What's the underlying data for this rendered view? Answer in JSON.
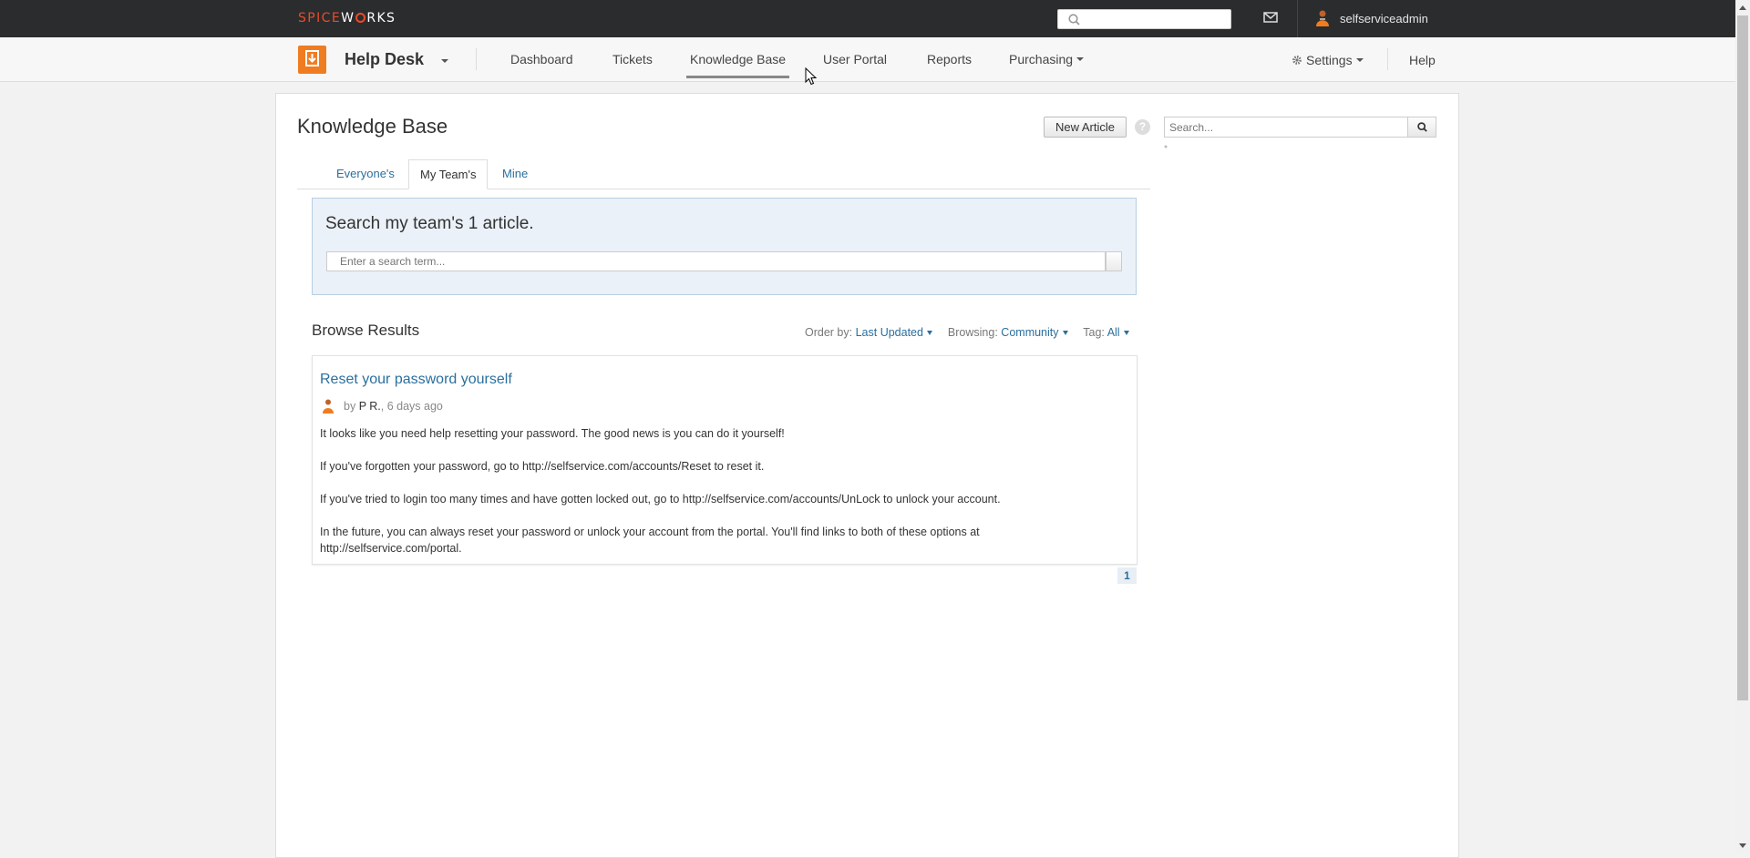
{
  "topbar": {
    "brand_left": "SPICE",
    "brand_right": "W",
    "brand_tail": "RKS",
    "search_placeholder": "",
    "username": "selfserviceadmin",
    "icons": [
      "search-icon",
      "mail-icon",
      "user-avatar-icon"
    ]
  },
  "nav": {
    "app_title": "Help Desk",
    "items": [
      {
        "label": "Dashboard"
      },
      {
        "label": "Tickets"
      },
      {
        "label": "Knowledge Base",
        "active": true
      },
      {
        "label": "User Portal"
      },
      {
        "label": "Reports"
      },
      {
        "label": "Purchasing"
      }
    ],
    "settings_label": "Settings",
    "help_label": "Help"
  },
  "page": {
    "title": "Knowledge Base",
    "new_article_label": "New Article",
    "help_glyph": "?",
    "side_search_placeholder": "Search..."
  },
  "tabs": [
    {
      "label": "Everyone's"
    },
    {
      "label": "My Team's",
      "active": true
    },
    {
      "label": "Mine"
    }
  ],
  "search": {
    "heading": "Search my team's 1 article.",
    "placeholder": "Enter a search term..."
  },
  "browse": {
    "title": "Browse Results",
    "order_label": "Order by:",
    "order_value": "Last Updated",
    "browsing_label": "Browsing:",
    "browsing_value": "Community",
    "tag_label": "Tag:",
    "tag_value": "All"
  },
  "article": {
    "title": "Reset your password yourself",
    "by": "by",
    "author": "P R.",
    "age": ", 6 days ago",
    "paragraphs": [
      "It looks like you need help resetting your password. The good news is you can do it yourself!",
      "If you've forgotten your password, go to http://selfservice.com/accounts/Reset to reset it.",
      "If you've tried to login too many times and have gotten locked out, go to http://selfservice.com/accounts/UnLock to unlock your account.",
      "In the future, you can always reset your password or unlock your account from the portal. You'll find links to both of these options at http://selfservice.com/portal."
    ]
  },
  "pagination": {
    "current": "1"
  },
  "colors": {
    "topbar": "#2b2c2e",
    "brand_red": "#ea4b2a",
    "accent_orange": "#f07c22",
    "link": "#2a6f9e",
    "search_panel": "#eaf1f8"
  }
}
